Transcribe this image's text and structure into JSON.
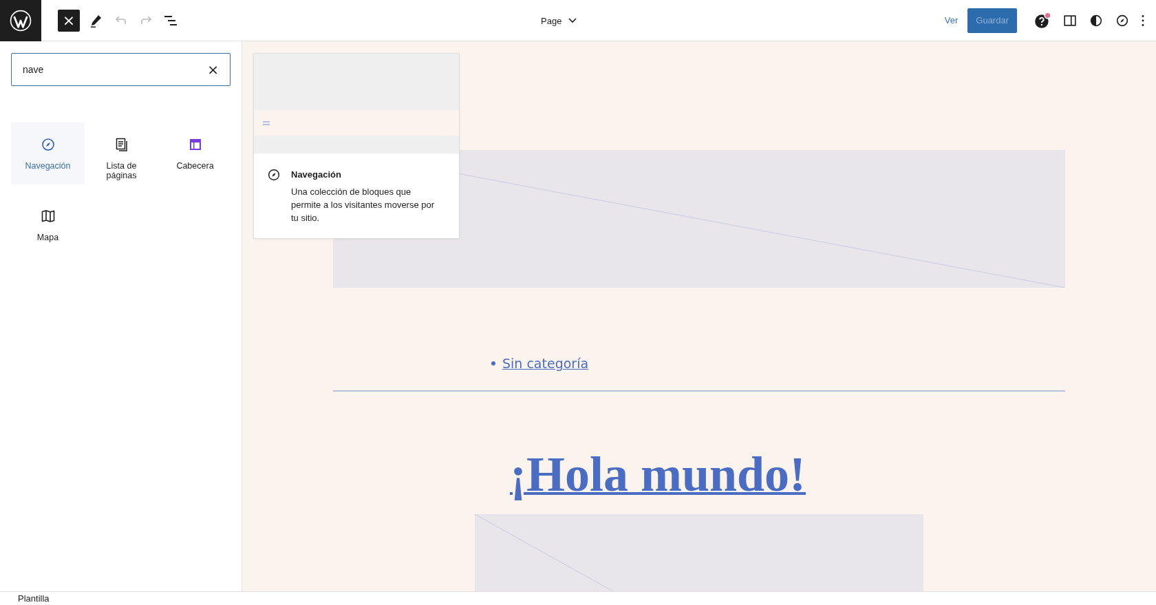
{
  "toolbar": {
    "close_inserter": "×",
    "undo": {
      "disabled": true
    },
    "redo": {
      "disabled": true
    },
    "document": "Page",
    "view": "Ver",
    "save": {
      "label": "Guardar",
      "disabled": true
    },
    "help_notification": true
  },
  "inserter": {
    "search": {
      "value": "nave",
      "clear": "×"
    },
    "blocks": [
      {
        "label": "Navegación",
        "selected": true
      },
      {
        "label": "Lista de páginas",
        "selected": false
      },
      {
        "label": "Cabecera",
        "selected": false
      },
      {
        "label": "Mapa",
        "selected": false
      }
    ]
  },
  "preview": {
    "title": "Navegación",
    "description": "Una colección de bloques que permite a los visitantes moverse por tu sitio."
  },
  "canvas": {
    "category_link": "Sin categoría",
    "post_title": "¡Hola mundo!"
  },
  "status_bar": {
    "breadcrumb": "Plantilla"
  }
}
